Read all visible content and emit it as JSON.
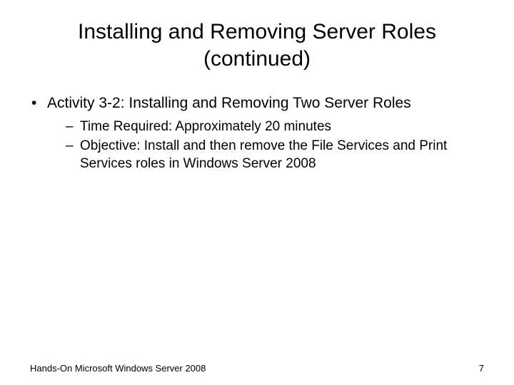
{
  "title": "Installing and Removing Server Roles (continued)",
  "bullets": {
    "b0": {
      "text": "Activity 3-2: Installing and Removing Two Server Roles",
      "sub": {
        "s0": "Time Required: Approximately 20 minutes",
        "s1": "Objective: Install and then remove the File Services and Print Services roles in Windows Server 2008"
      }
    }
  },
  "footer": {
    "left": "Hands-On Microsoft Windows Server 2008",
    "right": "7"
  }
}
